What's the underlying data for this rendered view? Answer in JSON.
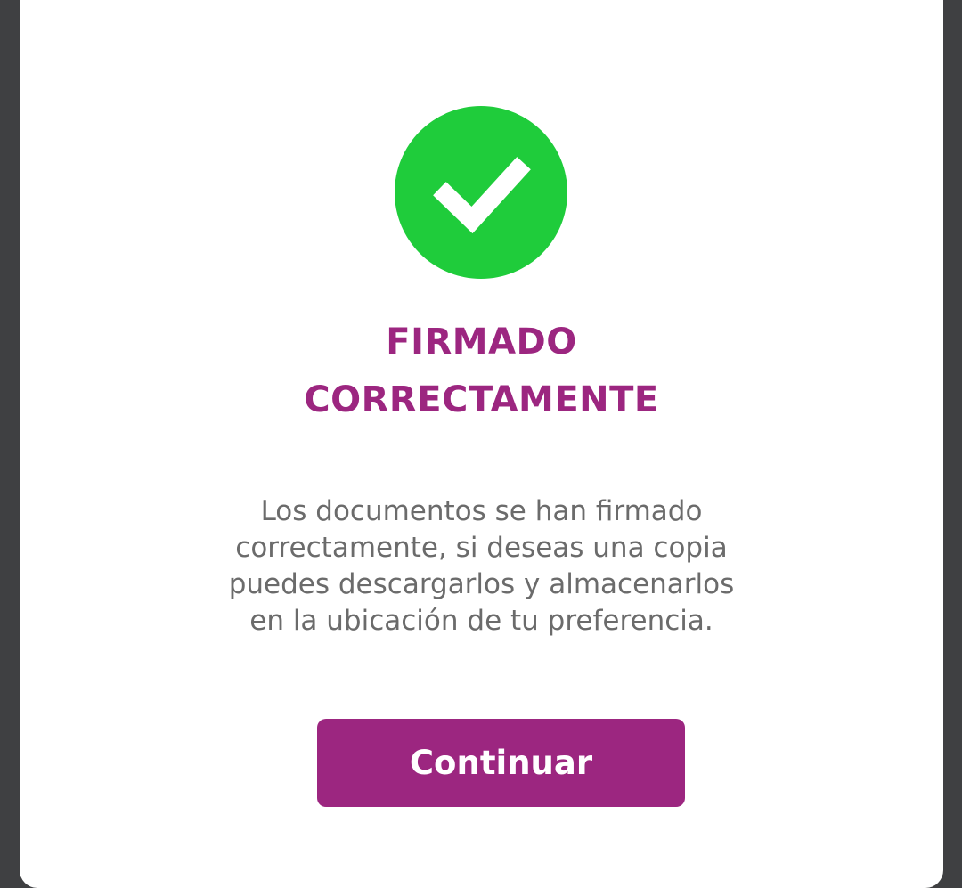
{
  "colors": {
    "accent": "#9c2680",
    "success": "#1fcc3b",
    "backdrop": "#3f4042",
    "body_text": "#6b6b6b"
  },
  "icon": "check-circle-icon",
  "dialog": {
    "title_lines": [
      "FIRMADO",
      "CORRECTAMENTE"
    ],
    "message_lines": [
      "Los documentos se han firmado",
      "correctamente, si deseas una copia",
      "puedes descargarlos y almacenarlos",
      "en la ubicación de tu preferencia."
    ],
    "continue_label": "Continuar"
  }
}
